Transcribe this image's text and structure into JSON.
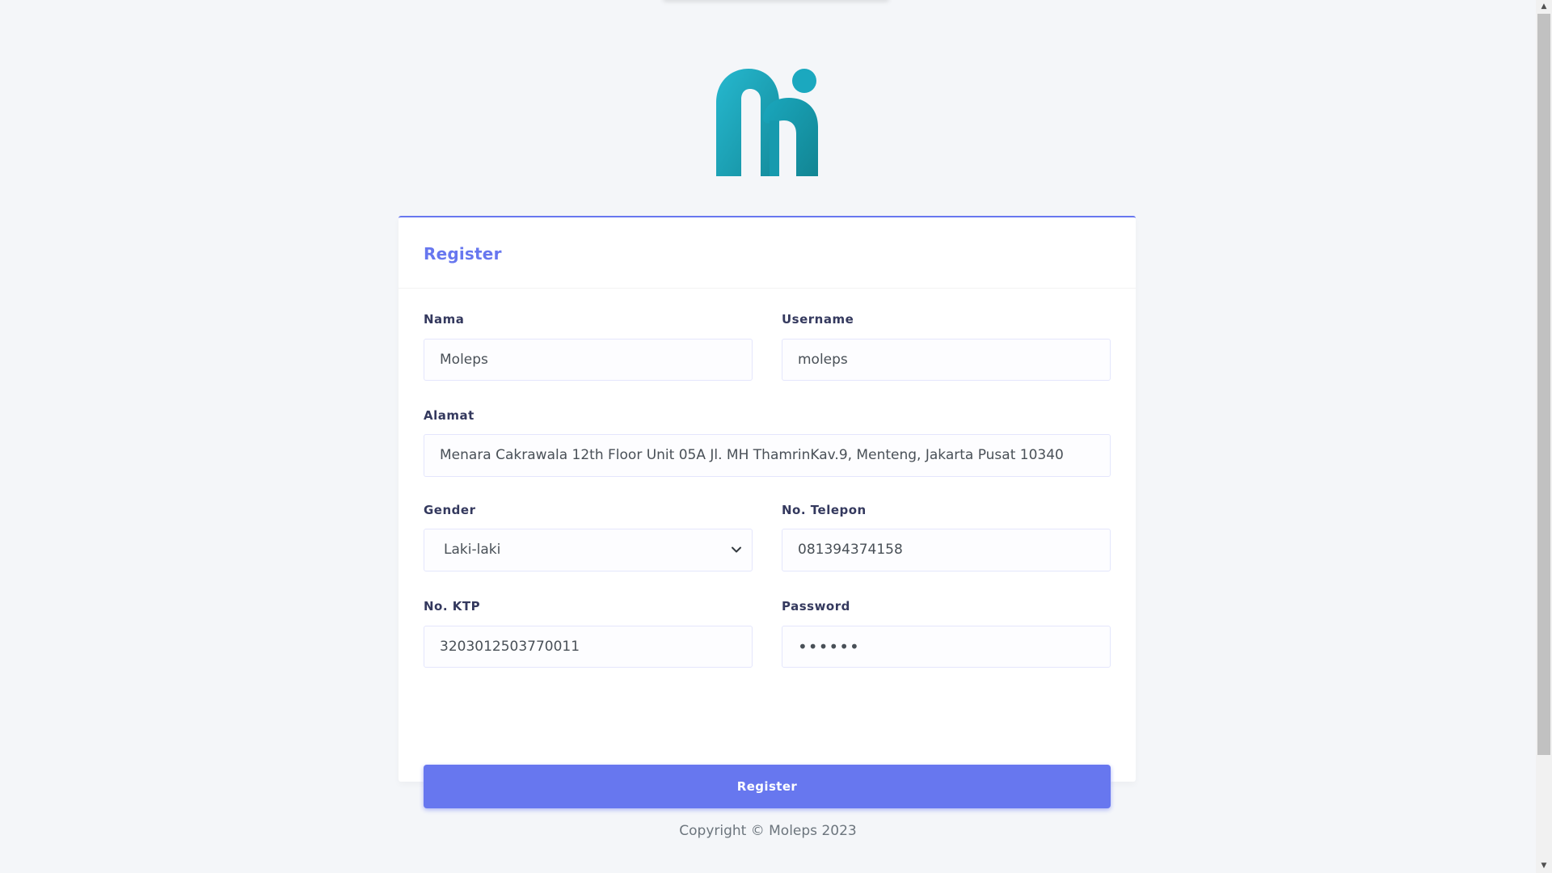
{
  "brand": {
    "logo_icon": "m-logo-icon",
    "logo_gradient": [
      "#26b8cf",
      "#158f9e"
    ]
  },
  "register_form": {
    "title": "Register",
    "fields": {
      "nama": {
        "label": "Nama",
        "value": "Moleps"
      },
      "username": {
        "label": "Username",
        "value": "moleps"
      },
      "alamat": {
        "label": "Alamat",
        "value": "Menara Cakrawala 12th Floor Unit 05A Jl. MH ThamrinKav.9, Menteng, Jakarta Pusat 10340"
      },
      "gender": {
        "label": "Gender",
        "value": "Laki-laki",
        "icon": "chevron-down-icon"
      },
      "telepon": {
        "label": "No. Telepon",
        "value": "081394374158"
      },
      "ktp": {
        "label": "No. KTP",
        "value": "3203012503770011"
      },
      "password": {
        "label": "Password",
        "value": "••••••"
      }
    },
    "submit_label": "Register"
  },
  "footer": {
    "copyright": "Copyright © Moleps 2023"
  },
  "colors": {
    "primary": "#6777ef",
    "background": "#f4f6f9",
    "label": "#34395e"
  }
}
